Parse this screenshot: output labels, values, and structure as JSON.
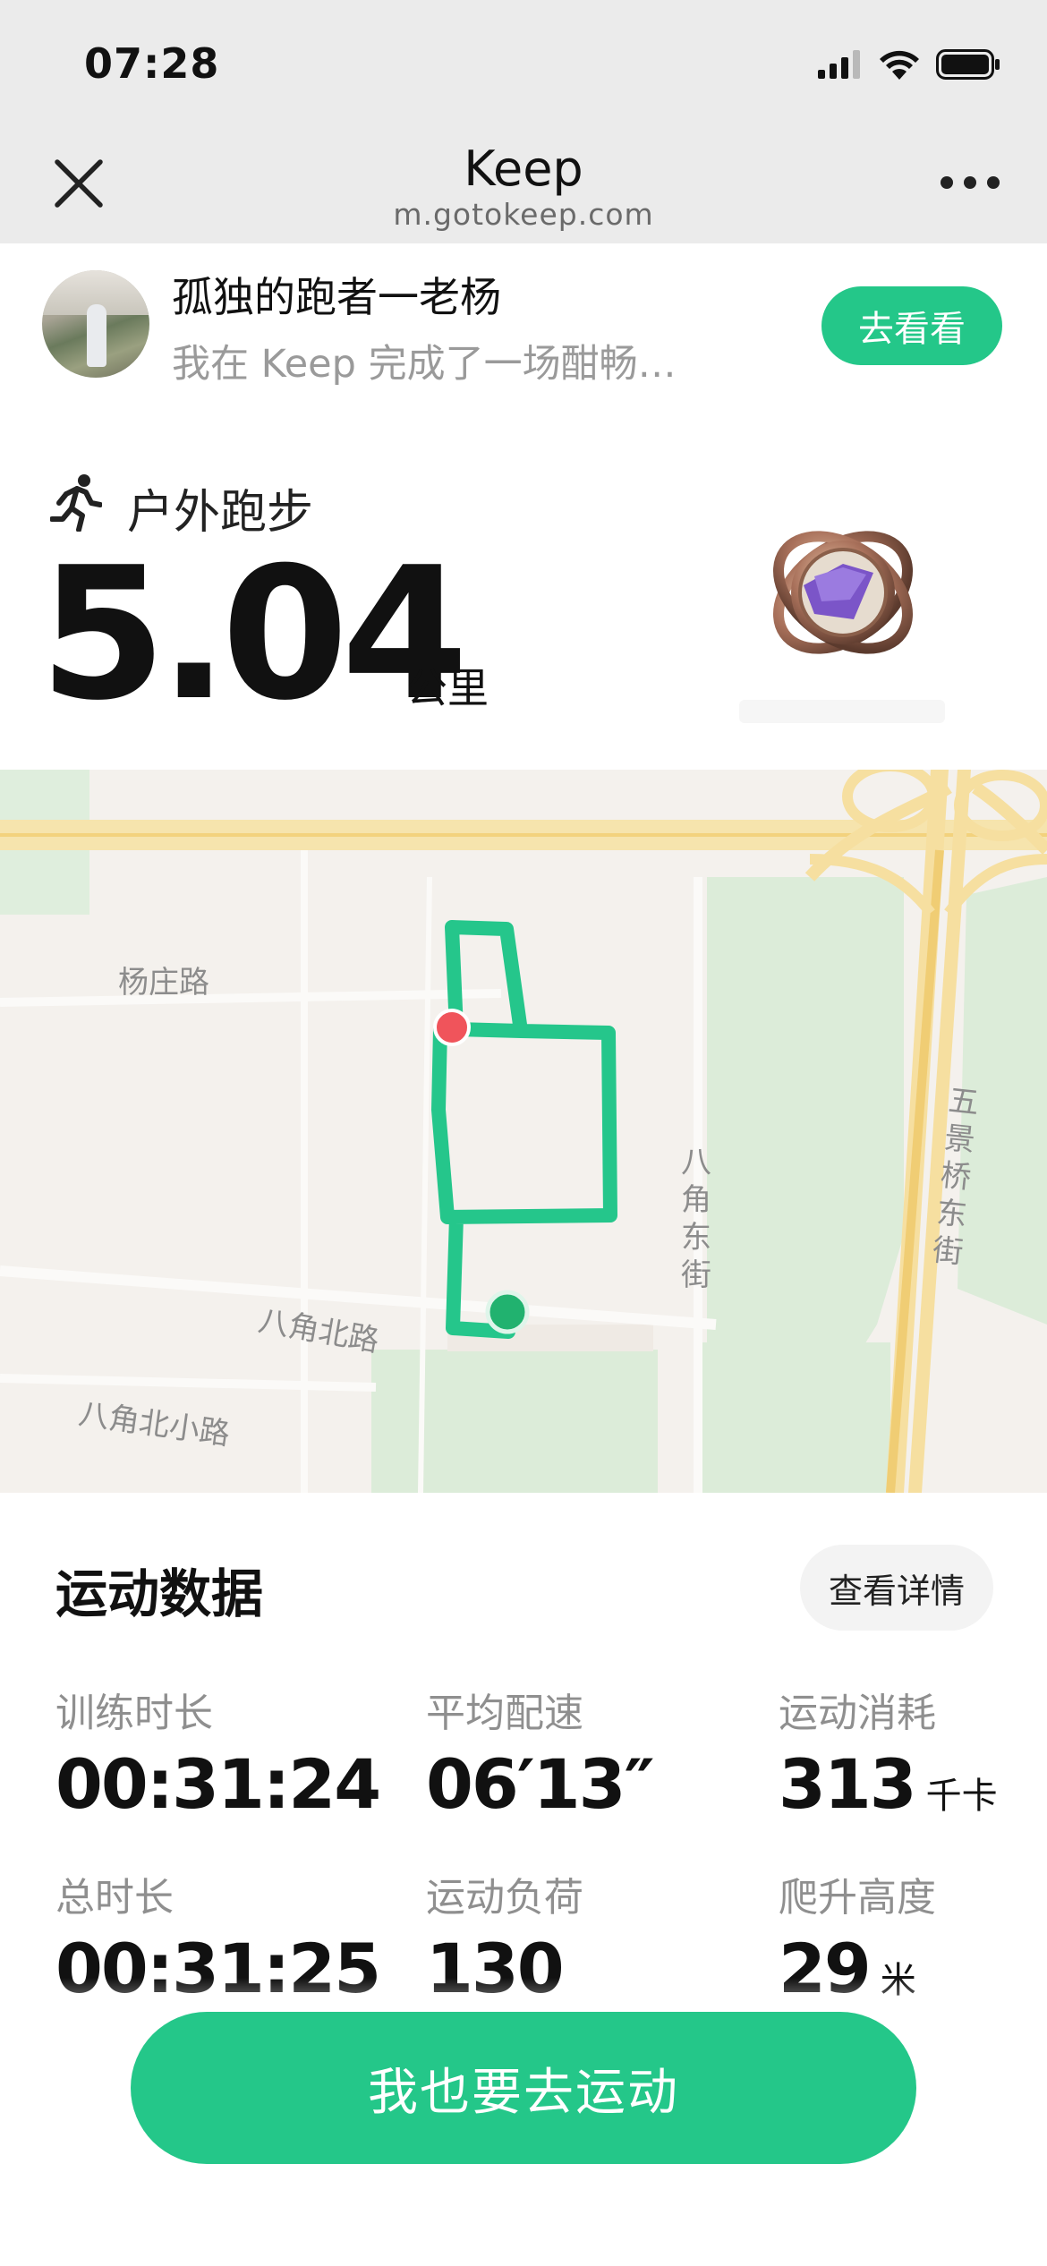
{
  "status_bar": {
    "time": "07:28"
  },
  "browser": {
    "title": "Keep",
    "url": "m.gotokeep.com"
  },
  "share": {
    "user_name": "孤独的跑者一老杨",
    "message": "我在 Keep 完成了一场酣畅…",
    "button_label": "去看看"
  },
  "activity": {
    "type_label": "户外跑步",
    "distance": "5.04",
    "distance_unit": "公里",
    "icon": "runner-icon"
  },
  "map": {
    "labels": {
      "yangzhuang_rd": "杨庄路",
      "bajiao_east_st": "八角东街",
      "wujingqiao_east_st": "五景桥东街",
      "bajiao_north_rd": "八角北路",
      "bajiao_north_small_rd": "八角北小路"
    },
    "route_color": "#25c68b",
    "start_marker_color": "#21b26f",
    "end_marker_color": "#f0545b"
  },
  "stats": {
    "section_title": "运动数据",
    "detail_button": "查看详情",
    "items": [
      {
        "label": "训练时长",
        "value": "00:31:24",
        "unit": ""
      },
      {
        "label": "平均配速",
        "value": "06′13″",
        "unit": ""
      },
      {
        "label": "运动消耗",
        "value": "313",
        "unit": "千卡"
      },
      {
        "label": "总时长",
        "value": "00:31:25",
        "unit": ""
      },
      {
        "label": "运动负荷",
        "value": "130",
        "unit": ""
      },
      {
        "label": "爬升高度",
        "value": "29",
        "unit": "米"
      }
    ]
  },
  "cta": {
    "label": "我也要去运动"
  },
  "colors": {
    "brand_green": "#24c789",
    "header_bg": "#ebebeb"
  }
}
